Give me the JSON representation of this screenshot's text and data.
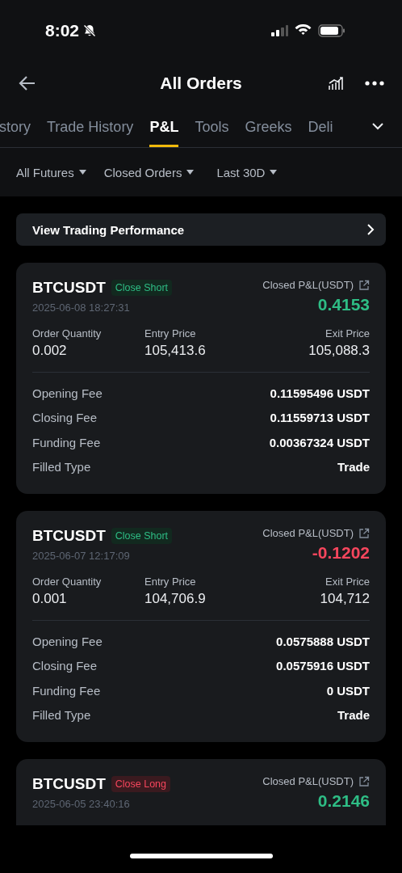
{
  "status_bar": {
    "time": "8:02"
  },
  "header": {
    "title": "All Orders"
  },
  "tabs": [
    {
      "label": "story",
      "selected": false
    },
    {
      "label": "Trade History",
      "selected": false
    },
    {
      "label": "P&L",
      "selected": true
    },
    {
      "label": "Tools",
      "selected": false
    },
    {
      "label": "Greeks",
      "selected": false
    },
    {
      "label": "Deli",
      "selected": false
    }
  ],
  "filters": [
    {
      "label": "All Futures"
    },
    {
      "label": "Closed Orders"
    },
    {
      "label": "Last 30D"
    }
  ],
  "banner": {
    "label": "View Trading Performance"
  },
  "orders": [
    {
      "symbol": "BTCUSDT",
      "badge": "Close Short",
      "kind": "short",
      "time": "2025-06-08 18:27:31",
      "pnl_label": "Closed P&L(USDT)",
      "pnl": "0.4153",
      "negative": false,
      "stats": [
        {
          "label": "Order Quantity",
          "value": "0.002"
        },
        {
          "label": "Entry Price",
          "value": "105,413.6"
        },
        {
          "label": "Exit Price",
          "value": "105,088.3"
        }
      ],
      "fees": [
        {
          "label": "Opening Fee",
          "value": "0.11595496 USDT"
        },
        {
          "label": "Closing Fee",
          "value": "0.11559713 USDT"
        },
        {
          "label": "Funding Fee",
          "value": "0.00367324 USDT"
        },
        {
          "label": "Filled Type",
          "value": "Trade"
        }
      ]
    },
    {
      "symbol": "BTCUSDT",
      "badge": "Close Short",
      "kind": "short",
      "time": "2025-06-07 12:17:09",
      "pnl_label": "Closed P&L(USDT)",
      "pnl": "-0.1202",
      "negative": true,
      "stats": [
        {
          "label": "Order Quantity",
          "value": "0.001"
        },
        {
          "label": "Entry Price",
          "value": "104,706.9"
        },
        {
          "label": "Exit Price",
          "value": "104,712"
        }
      ],
      "fees": [
        {
          "label": "Opening Fee",
          "value": "0.0575888 USDT"
        },
        {
          "label": "Closing Fee",
          "value": "0.0575916 USDT"
        },
        {
          "label": "Funding Fee",
          "value": "0 USDT"
        },
        {
          "label": "Filled Type",
          "value": "Trade"
        }
      ]
    },
    {
      "symbol": "BTCUSDT",
      "badge": "Close Long",
      "kind": "long",
      "time": "2025-06-05 23:40:16",
      "pnl_label": "Closed P&L(USDT)",
      "pnl": "0.2146",
      "negative": false
    }
  ]
}
